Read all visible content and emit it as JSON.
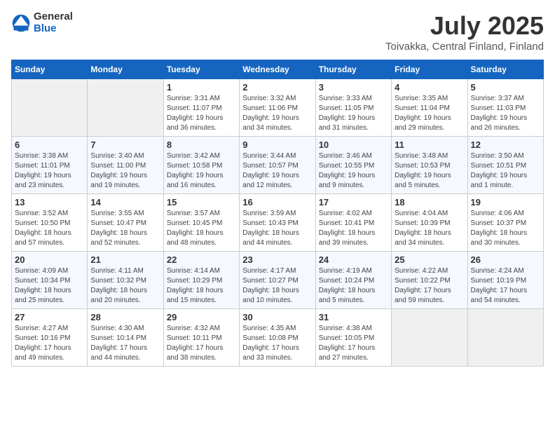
{
  "header": {
    "logo": {
      "text_general": "General",
      "text_blue": "Blue"
    },
    "title": "July 2025",
    "subtitle": "Toivakka, Central Finland, Finland"
  },
  "weekdays": [
    "Sunday",
    "Monday",
    "Tuesday",
    "Wednesday",
    "Thursday",
    "Friday",
    "Saturday"
  ],
  "weeks": [
    [
      {
        "day": "",
        "empty": true
      },
      {
        "day": "",
        "empty": true
      },
      {
        "day": "1",
        "sunrise": "Sunrise: 3:31 AM",
        "sunset": "Sunset: 11:07 PM",
        "daylight": "Daylight: 19 hours and 36 minutes."
      },
      {
        "day": "2",
        "sunrise": "Sunrise: 3:32 AM",
        "sunset": "Sunset: 11:06 PM",
        "daylight": "Daylight: 19 hours and 34 minutes."
      },
      {
        "day": "3",
        "sunrise": "Sunrise: 3:33 AM",
        "sunset": "Sunset: 11:05 PM",
        "daylight": "Daylight: 19 hours and 31 minutes."
      },
      {
        "day": "4",
        "sunrise": "Sunrise: 3:35 AM",
        "sunset": "Sunset: 11:04 PM",
        "daylight": "Daylight: 19 hours and 29 minutes."
      },
      {
        "day": "5",
        "sunrise": "Sunrise: 3:37 AM",
        "sunset": "Sunset: 11:03 PM",
        "daylight": "Daylight: 19 hours and 26 minutes."
      }
    ],
    [
      {
        "day": "6",
        "sunrise": "Sunrise: 3:38 AM",
        "sunset": "Sunset: 11:01 PM",
        "daylight": "Daylight: 19 hours and 23 minutes."
      },
      {
        "day": "7",
        "sunrise": "Sunrise: 3:40 AM",
        "sunset": "Sunset: 11:00 PM",
        "daylight": "Daylight: 19 hours and 19 minutes."
      },
      {
        "day": "8",
        "sunrise": "Sunrise: 3:42 AM",
        "sunset": "Sunset: 10:58 PM",
        "daylight": "Daylight: 19 hours and 16 minutes."
      },
      {
        "day": "9",
        "sunrise": "Sunrise: 3:44 AM",
        "sunset": "Sunset: 10:57 PM",
        "daylight": "Daylight: 19 hours and 12 minutes."
      },
      {
        "day": "10",
        "sunrise": "Sunrise: 3:46 AM",
        "sunset": "Sunset: 10:55 PM",
        "daylight": "Daylight: 19 hours and 9 minutes."
      },
      {
        "day": "11",
        "sunrise": "Sunrise: 3:48 AM",
        "sunset": "Sunset: 10:53 PM",
        "daylight": "Daylight: 19 hours and 5 minutes."
      },
      {
        "day": "12",
        "sunrise": "Sunrise: 3:50 AM",
        "sunset": "Sunset: 10:51 PM",
        "daylight": "Daylight: 19 hours and 1 minute."
      }
    ],
    [
      {
        "day": "13",
        "sunrise": "Sunrise: 3:52 AM",
        "sunset": "Sunset: 10:50 PM",
        "daylight": "Daylight: 18 hours and 57 minutes."
      },
      {
        "day": "14",
        "sunrise": "Sunrise: 3:55 AM",
        "sunset": "Sunset: 10:47 PM",
        "daylight": "Daylight: 18 hours and 52 minutes."
      },
      {
        "day": "15",
        "sunrise": "Sunrise: 3:57 AM",
        "sunset": "Sunset: 10:45 PM",
        "daylight": "Daylight: 18 hours and 48 minutes."
      },
      {
        "day": "16",
        "sunrise": "Sunrise: 3:59 AM",
        "sunset": "Sunset: 10:43 PM",
        "daylight": "Daylight: 18 hours and 44 minutes."
      },
      {
        "day": "17",
        "sunrise": "Sunrise: 4:02 AM",
        "sunset": "Sunset: 10:41 PM",
        "daylight": "Daylight: 18 hours and 39 minutes."
      },
      {
        "day": "18",
        "sunrise": "Sunrise: 4:04 AM",
        "sunset": "Sunset: 10:39 PM",
        "daylight": "Daylight: 18 hours and 34 minutes."
      },
      {
        "day": "19",
        "sunrise": "Sunrise: 4:06 AM",
        "sunset": "Sunset: 10:37 PM",
        "daylight": "Daylight: 18 hours and 30 minutes."
      }
    ],
    [
      {
        "day": "20",
        "sunrise": "Sunrise: 4:09 AM",
        "sunset": "Sunset: 10:34 PM",
        "daylight": "Daylight: 18 hours and 25 minutes."
      },
      {
        "day": "21",
        "sunrise": "Sunrise: 4:11 AM",
        "sunset": "Sunset: 10:32 PM",
        "daylight": "Daylight: 18 hours and 20 minutes."
      },
      {
        "day": "22",
        "sunrise": "Sunrise: 4:14 AM",
        "sunset": "Sunset: 10:29 PM",
        "daylight": "Daylight: 18 hours and 15 minutes."
      },
      {
        "day": "23",
        "sunrise": "Sunrise: 4:17 AM",
        "sunset": "Sunset: 10:27 PM",
        "daylight": "Daylight: 18 hours and 10 minutes."
      },
      {
        "day": "24",
        "sunrise": "Sunrise: 4:19 AM",
        "sunset": "Sunset: 10:24 PM",
        "daylight": "Daylight: 18 hours and 5 minutes."
      },
      {
        "day": "25",
        "sunrise": "Sunrise: 4:22 AM",
        "sunset": "Sunset: 10:22 PM",
        "daylight": "Daylight: 17 hours and 59 minutes."
      },
      {
        "day": "26",
        "sunrise": "Sunrise: 4:24 AM",
        "sunset": "Sunset: 10:19 PM",
        "daylight": "Daylight: 17 hours and 54 minutes."
      }
    ],
    [
      {
        "day": "27",
        "sunrise": "Sunrise: 4:27 AM",
        "sunset": "Sunset: 10:16 PM",
        "daylight": "Daylight: 17 hours and 49 minutes."
      },
      {
        "day": "28",
        "sunrise": "Sunrise: 4:30 AM",
        "sunset": "Sunset: 10:14 PM",
        "daylight": "Daylight: 17 hours and 44 minutes."
      },
      {
        "day": "29",
        "sunrise": "Sunrise: 4:32 AM",
        "sunset": "Sunset: 10:11 PM",
        "daylight": "Daylight: 17 hours and 38 minutes."
      },
      {
        "day": "30",
        "sunrise": "Sunrise: 4:35 AM",
        "sunset": "Sunset: 10:08 PM",
        "daylight": "Daylight: 17 hours and 33 minutes."
      },
      {
        "day": "31",
        "sunrise": "Sunrise: 4:38 AM",
        "sunset": "Sunset: 10:05 PM",
        "daylight": "Daylight: 17 hours and 27 minutes."
      },
      {
        "day": "",
        "empty": true
      },
      {
        "day": "",
        "empty": true
      }
    ]
  ]
}
